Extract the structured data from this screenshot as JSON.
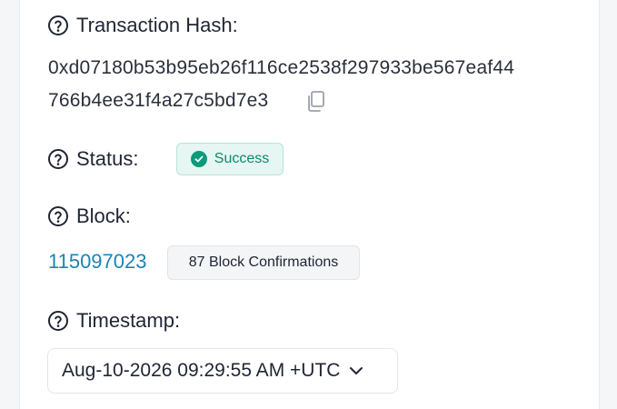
{
  "transaction": {
    "hash_label": "Transaction Hash:",
    "hash_line1": "0xd07180b53b95eb26f116ce2538f297933be567eaf44",
    "hash_line2": "766b4ee31f4a27c5bd7e3",
    "copy_icon": "copy-icon"
  },
  "status": {
    "label": "Status:",
    "value": "Success",
    "color": "#0b8a6e"
  },
  "block": {
    "label": "Block:",
    "number": "115097023",
    "confirmations": "87 Block Confirmations",
    "link_color": "#1c84b4"
  },
  "timestamp": {
    "label": "Timestamp:",
    "value": "Aug-10-2026 09:29:55 AM +UTC",
    "dropdown_icon": "chevron-down-icon"
  },
  "help_icon": "question-circle-icon"
}
